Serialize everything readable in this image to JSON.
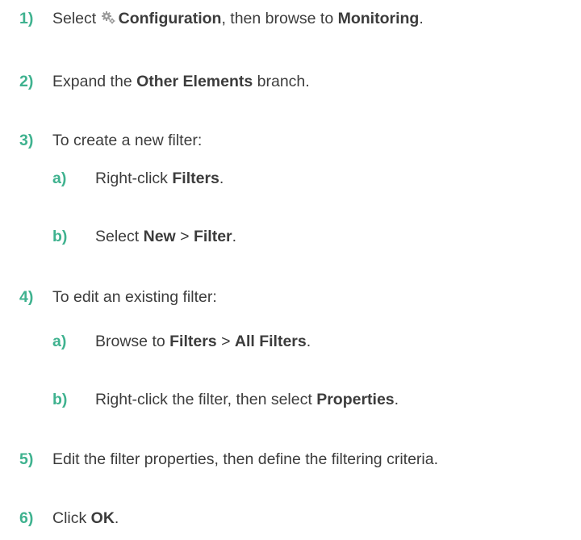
{
  "steps": [
    {
      "num": "1)",
      "parts": [
        [
          "t",
          "Select "
        ],
        [
          "icon",
          "gear-icon"
        ],
        [
          "b",
          "Configuration"
        ],
        [
          "t",
          ", then browse to "
        ],
        [
          "b",
          "Monitoring"
        ],
        [
          "t",
          "."
        ]
      ]
    },
    {
      "num": "2)",
      "parts": [
        [
          "t",
          "Expand the "
        ],
        [
          "b",
          "Other Elements"
        ],
        [
          "t",
          " branch."
        ]
      ]
    },
    {
      "num": "3)",
      "parts": [
        [
          "t",
          "To create a new filter:"
        ]
      ]
    },
    {
      "num": "a)",
      "parts": [
        [
          "t",
          "Right-click "
        ],
        [
          "b",
          "Filters"
        ],
        [
          "t",
          "."
        ]
      ]
    },
    {
      "num": "b)",
      "parts": [
        [
          "t",
          "Select "
        ],
        [
          "b",
          "New"
        ],
        [
          "t",
          " > "
        ],
        [
          "b",
          "Filter"
        ],
        [
          "t",
          "."
        ]
      ]
    },
    {
      "num": "4)",
      "parts": [
        [
          "t",
          "To edit an existing filter:"
        ]
      ]
    },
    {
      "num": "a)",
      "parts": [
        [
          "t",
          "Browse to "
        ],
        [
          "b",
          "Filters"
        ],
        [
          "t",
          " > "
        ],
        [
          "b",
          "All Filters"
        ],
        [
          "t",
          "."
        ]
      ]
    },
    {
      "num": "b)",
      "parts": [
        [
          "t",
          "Right-click the filter, then select "
        ],
        [
          "b",
          "Properties"
        ],
        [
          "t",
          "."
        ]
      ]
    },
    {
      "num": "5)",
      "parts": [
        [
          "t",
          "Edit the filter properties, then define the filtering criteria."
        ]
      ]
    },
    {
      "num": "6)",
      "parts": [
        [
          "t",
          "Click "
        ],
        [
          "b",
          "OK"
        ],
        [
          "t",
          "."
        ]
      ]
    }
  ],
  "colors": {
    "accent": "#3fb28f",
    "text": "#3c3c3c"
  }
}
